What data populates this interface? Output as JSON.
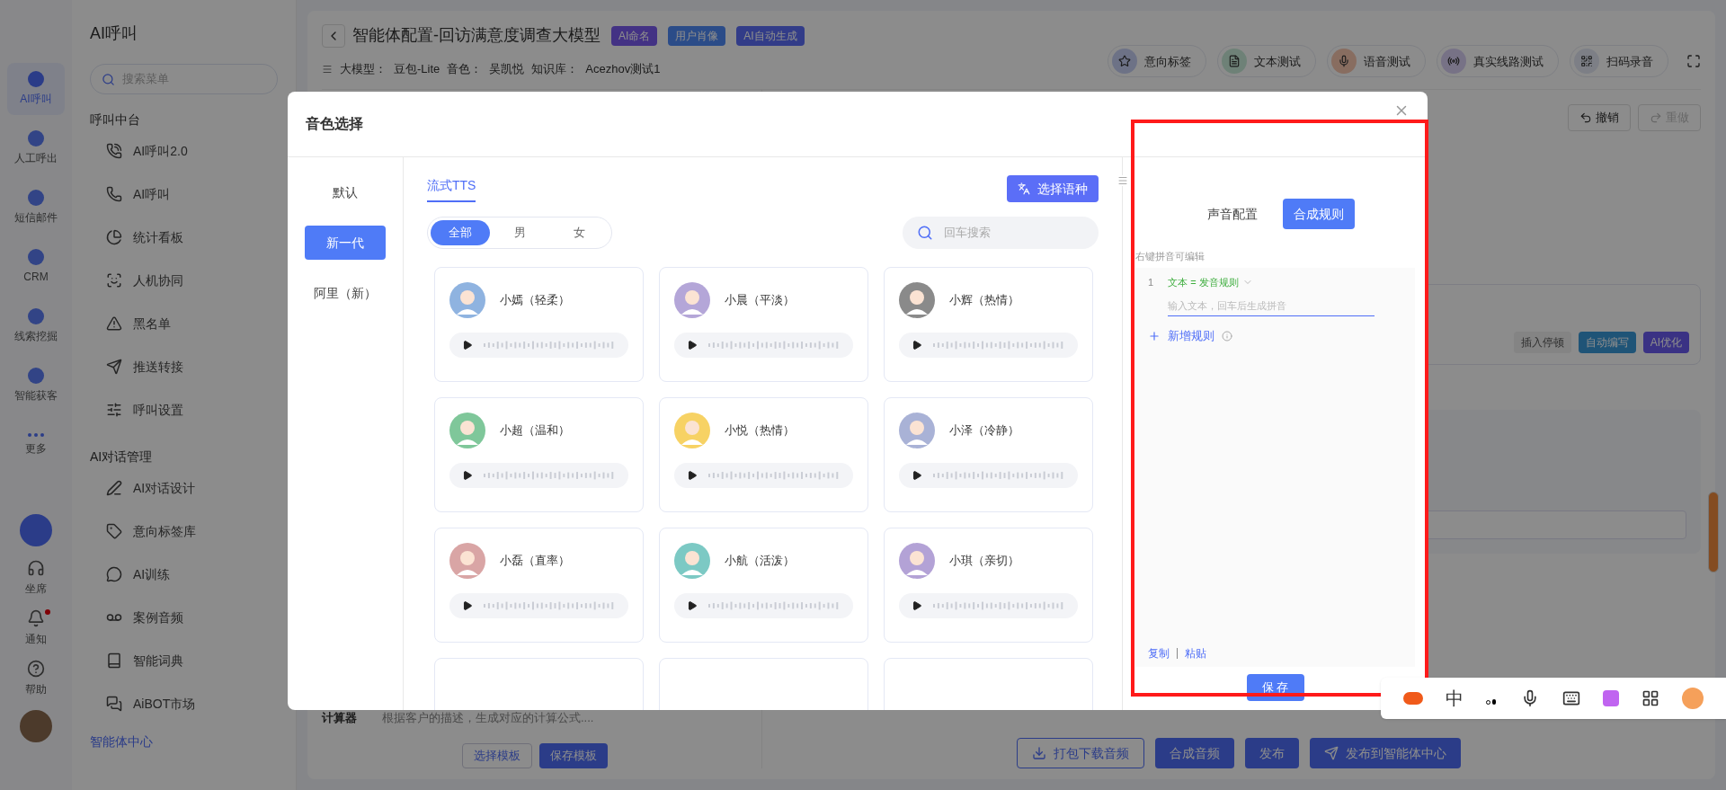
{
  "rail": {
    "items": [
      {
        "label": "AI呼叫",
        "selected": true
      },
      {
        "label": "人工呼出",
        "selected": false
      },
      {
        "label": "短信邮件",
        "selected": false
      },
      {
        "label": "CRM",
        "selected": false
      },
      {
        "label": "线索挖掘",
        "selected": false
      },
      {
        "label": "智能获客",
        "selected": false
      },
      {
        "label": "更多",
        "selected": false
      }
    ],
    "bottom": [
      {
        "label": "坐席",
        "badge": false
      },
      {
        "label": "通知",
        "badge": true
      },
      {
        "label": "帮助",
        "badge": false
      }
    ]
  },
  "menu": {
    "title": "AI呼叫",
    "search_placeholder": "搜索菜单",
    "sections": [
      {
        "title": "呼叫中台",
        "items": [
          "AI呼叫2.0",
          "AI呼叫",
          "统计看板",
          "人机协同",
          "黑名单",
          "推送转接",
          "呼叫设置"
        ]
      },
      {
        "title": "AI对话管理",
        "items": [
          "AI对话设计",
          "意向标签库",
          "AI训练",
          "案例音频",
          "智能词典",
          "AiBOT市场"
        ]
      }
    ],
    "footer": "智能体中心"
  },
  "header": {
    "title": "智能体配置-回访满意度调查大模型",
    "badges": [
      "AI命名",
      "用户肖像",
      "AI自动生成"
    ],
    "meta": [
      {
        "label": "大模型：",
        "value": "豆包-Lite"
      },
      {
        "label": "音色：",
        "value": "吴凯悦"
      },
      {
        "label": "知识库：",
        "value": "Acezhov测试1"
      }
    ],
    "actions": [
      "意向标签",
      "文本测试",
      "语音测试",
      "真实线路测试",
      "扫码录音"
    ]
  },
  "editor": {
    "undo": {
      "label": "撤销",
      "disabled": false
    },
    "redo": {
      "label": "重做",
      "disabled": true
    },
    "tools": [
      "插入停顿",
      "自动编写",
      "AI优化"
    ]
  },
  "template": {
    "name": "计算器",
    "description": "根据客户的描述，生成对应的计算公式....",
    "buttons": [
      "选择模板",
      "保存模板"
    ]
  },
  "footer_buttons": [
    "打包下载音频",
    "合成音频",
    "发布",
    "发布到智能体中心"
  ],
  "dialog": {
    "title": "音色选择",
    "categories": [
      {
        "label": "默认",
        "selected": false
      },
      {
        "label": "新一代",
        "selected": true
      },
      {
        "label": "阿里（新）",
        "selected": false
      }
    ],
    "tabs": [
      {
        "label": "流式TTS",
        "selected": true
      }
    ],
    "language_button": "选择语种",
    "gender_filter": [
      {
        "label": "全部",
        "selected": true
      },
      {
        "label": "男",
        "selected": false
      },
      {
        "label": "女",
        "selected": false
      }
    ],
    "search_placeholder": "回车搜索",
    "voices": [
      {
        "kind": "voice",
        "name": "小嫣（轻柔）",
        "color": "#8fb3e0"
      },
      {
        "kind": "voice",
        "name": "小晨（平淡）",
        "color": "#b4a6d8"
      },
      {
        "kind": "voice",
        "name": "小辉（热情）",
        "color": "#8a8a8a"
      },
      {
        "kind": "voice",
        "name": "小超（温和）",
        "color": "#7fc79a"
      },
      {
        "kind": "voice",
        "name": "小悦（热情）",
        "color": "#f7d264"
      },
      {
        "kind": "voice",
        "name": "小泽（冷静）",
        "color": "#a9b2d6"
      },
      {
        "kind": "voice",
        "name": "小磊（直率）",
        "color": "#d9a5a5"
      },
      {
        "kind": "voice",
        "name": "小航（活泼）",
        "color": "#7cc9c4"
      },
      {
        "kind": "voice",
        "name": "小琪（亲切）",
        "color": "#b3a2d6"
      },
      {
        "kind": "partial"
      },
      {
        "kind": "partial"
      },
      {
        "kind": "partial"
      }
    ],
    "settings_tabs": [
      {
        "label": "声音配置",
        "selected": false
      },
      {
        "label": "合成规则",
        "selected": true
      }
    ],
    "rules_hint": "右键拼音可编辑",
    "rules": [
      {
        "number": "1",
        "label": "文本 = 发音规则",
        "placeholder": "输入文本，回车后生成拼音"
      }
    ],
    "add_rule": "新增规则",
    "copy": "复制",
    "paste": "粘贴",
    "save": "保 存"
  },
  "ime_bar": {
    "mode": "中"
  }
}
